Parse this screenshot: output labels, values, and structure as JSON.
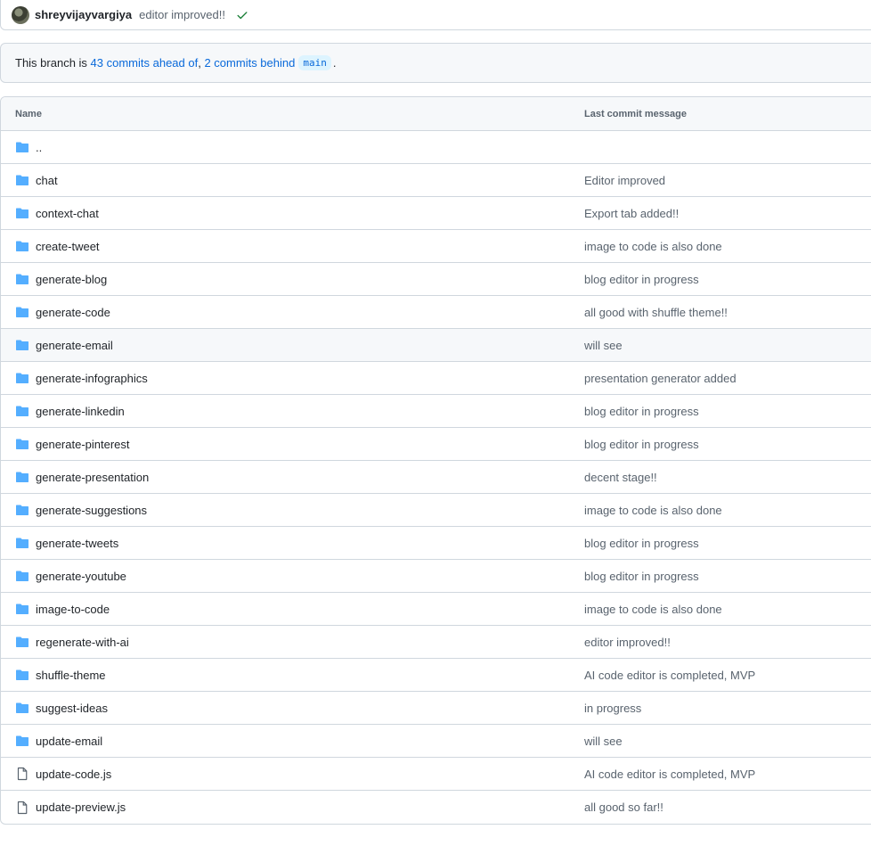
{
  "commit": {
    "author": "shreyvijayvargiya",
    "message": "editor improved!!",
    "status_icon": "check-icon"
  },
  "branch": {
    "prefix": "This branch is ",
    "ahead": "43 commits ahead of",
    "separator": ", ",
    "behind": "2 commits behind",
    "base": "main",
    "suffix": "."
  },
  "table": {
    "headers": {
      "name": "Name",
      "message": "Last commit message"
    },
    "rows": [
      {
        "type": "folder",
        "name": "..",
        "message": ""
      },
      {
        "type": "folder",
        "name": "chat",
        "message": "Editor improved"
      },
      {
        "type": "folder",
        "name": "context-chat",
        "message": "Export tab added!!"
      },
      {
        "type": "folder",
        "name": "create-tweet",
        "message": "image to code is also done"
      },
      {
        "type": "folder",
        "name": "generate-blog",
        "message": "blog editor in progress"
      },
      {
        "type": "folder",
        "name": "generate-code",
        "message": "all good with shuffle theme!!"
      },
      {
        "type": "folder",
        "name": "generate-email",
        "message": "will see"
      },
      {
        "type": "folder",
        "name": "generate-infographics",
        "message": "presentation generator added"
      },
      {
        "type": "folder",
        "name": "generate-linkedin",
        "message": "blog editor in progress"
      },
      {
        "type": "folder",
        "name": "generate-pinterest",
        "message": "blog editor in progress"
      },
      {
        "type": "folder",
        "name": "generate-presentation",
        "message": "decent stage!!"
      },
      {
        "type": "folder",
        "name": "generate-suggestions",
        "message": "image to code is also done"
      },
      {
        "type": "folder",
        "name": "generate-tweets",
        "message": "blog editor in progress"
      },
      {
        "type": "folder",
        "name": "generate-youtube",
        "message": "blog editor in progress"
      },
      {
        "type": "folder",
        "name": "image-to-code",
        "message": "image to code is also done"
      },
      {
        "type": "folder",
        "name": "regenerate-with-ai",
        "message": "editor improved!!"
      },
      {
        "type": "folder",
        "name": "shuffle-theme",
        "message": "AI code editor is completed, MVP"
      },
      {
        "type": "folder",
        "name": "suggest-ideas",
        "message": "in progress"
      },
      {
        "type": "folder",
        "name": "update-email",
        "message": "will see"
      },
      {
        "type": "file",
        "name": "update-code.js",
        "message": "AI code editor is completed, MVP"
      },
      {
        "type": "file",
        "name": "update-preview.js",
        "message": "all good so far!!"
      }
    ]
  },
  "colors": {
    "folder": "#54aeff",
    "file": "#59636e",
    "check": "#1a7f37",
    "link": "#0969da"
  }
}
